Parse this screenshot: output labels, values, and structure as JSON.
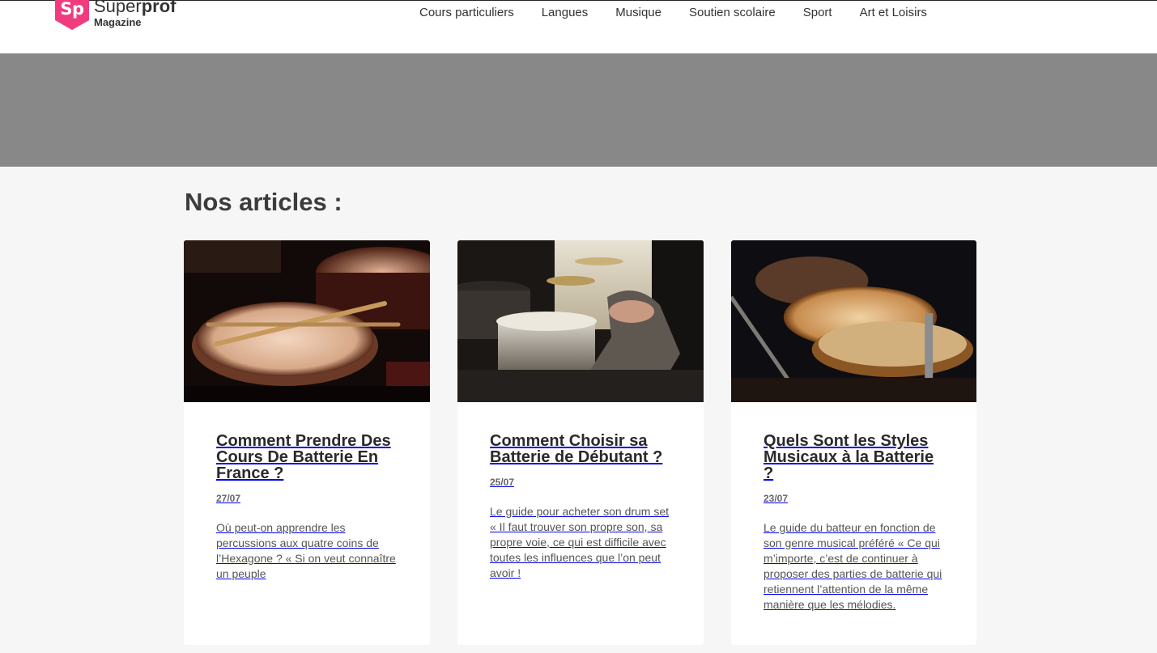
{
  "brand": {
    "badge": "Sp",
    "name_light": "Super",
    "name_bold": "prof",
    "sub": "Magazine",
    "color": "#f03c7e"
  },
  "nav": [
    {
      "label": "Cours particuliers"
    },
    {
      "label": "Langues"
    },
    {
      "label": "Musique"
    },
    {
      "label": "Soutien scolaire"
    },
    {
      "label": "Sport"
    },
    {
      "label": "Art et Loisirs"
    }
  ],
  "section_title": "Nos articles :",
  "articles": [
    {
      "title": "Comment Prendre Des Cours De Batterie En France ?",
      "date": "27/07",
      "excerpt": "Où peut-on apprendre les percussions aux quatre coins de l’Hexagone ? « Si on veut connaître un peuple"
    },
    {
      "title": "Comment Choisir sa Batterie de Débutant ?",
      "date": "25/07",
      "excerpt": "Le guide pour acheter son drum set « Il faut trouver son propre son, sa propre voie, ce qui est difficile avec toutes les influences que l’on peut avoir !"
    },
    {
      "title": "Quels Sont les Styles Musicaux à la Batterie ?",
      "date": "23/07",
      "excerpt": "Le guide du batteur en fonction de son genre musical préféré « Ce qui m’importe, c’est de continuer à proposer des parties de batterie qui retiennent l’attention de la même manière que les mélodies."
    }
  ]
}
